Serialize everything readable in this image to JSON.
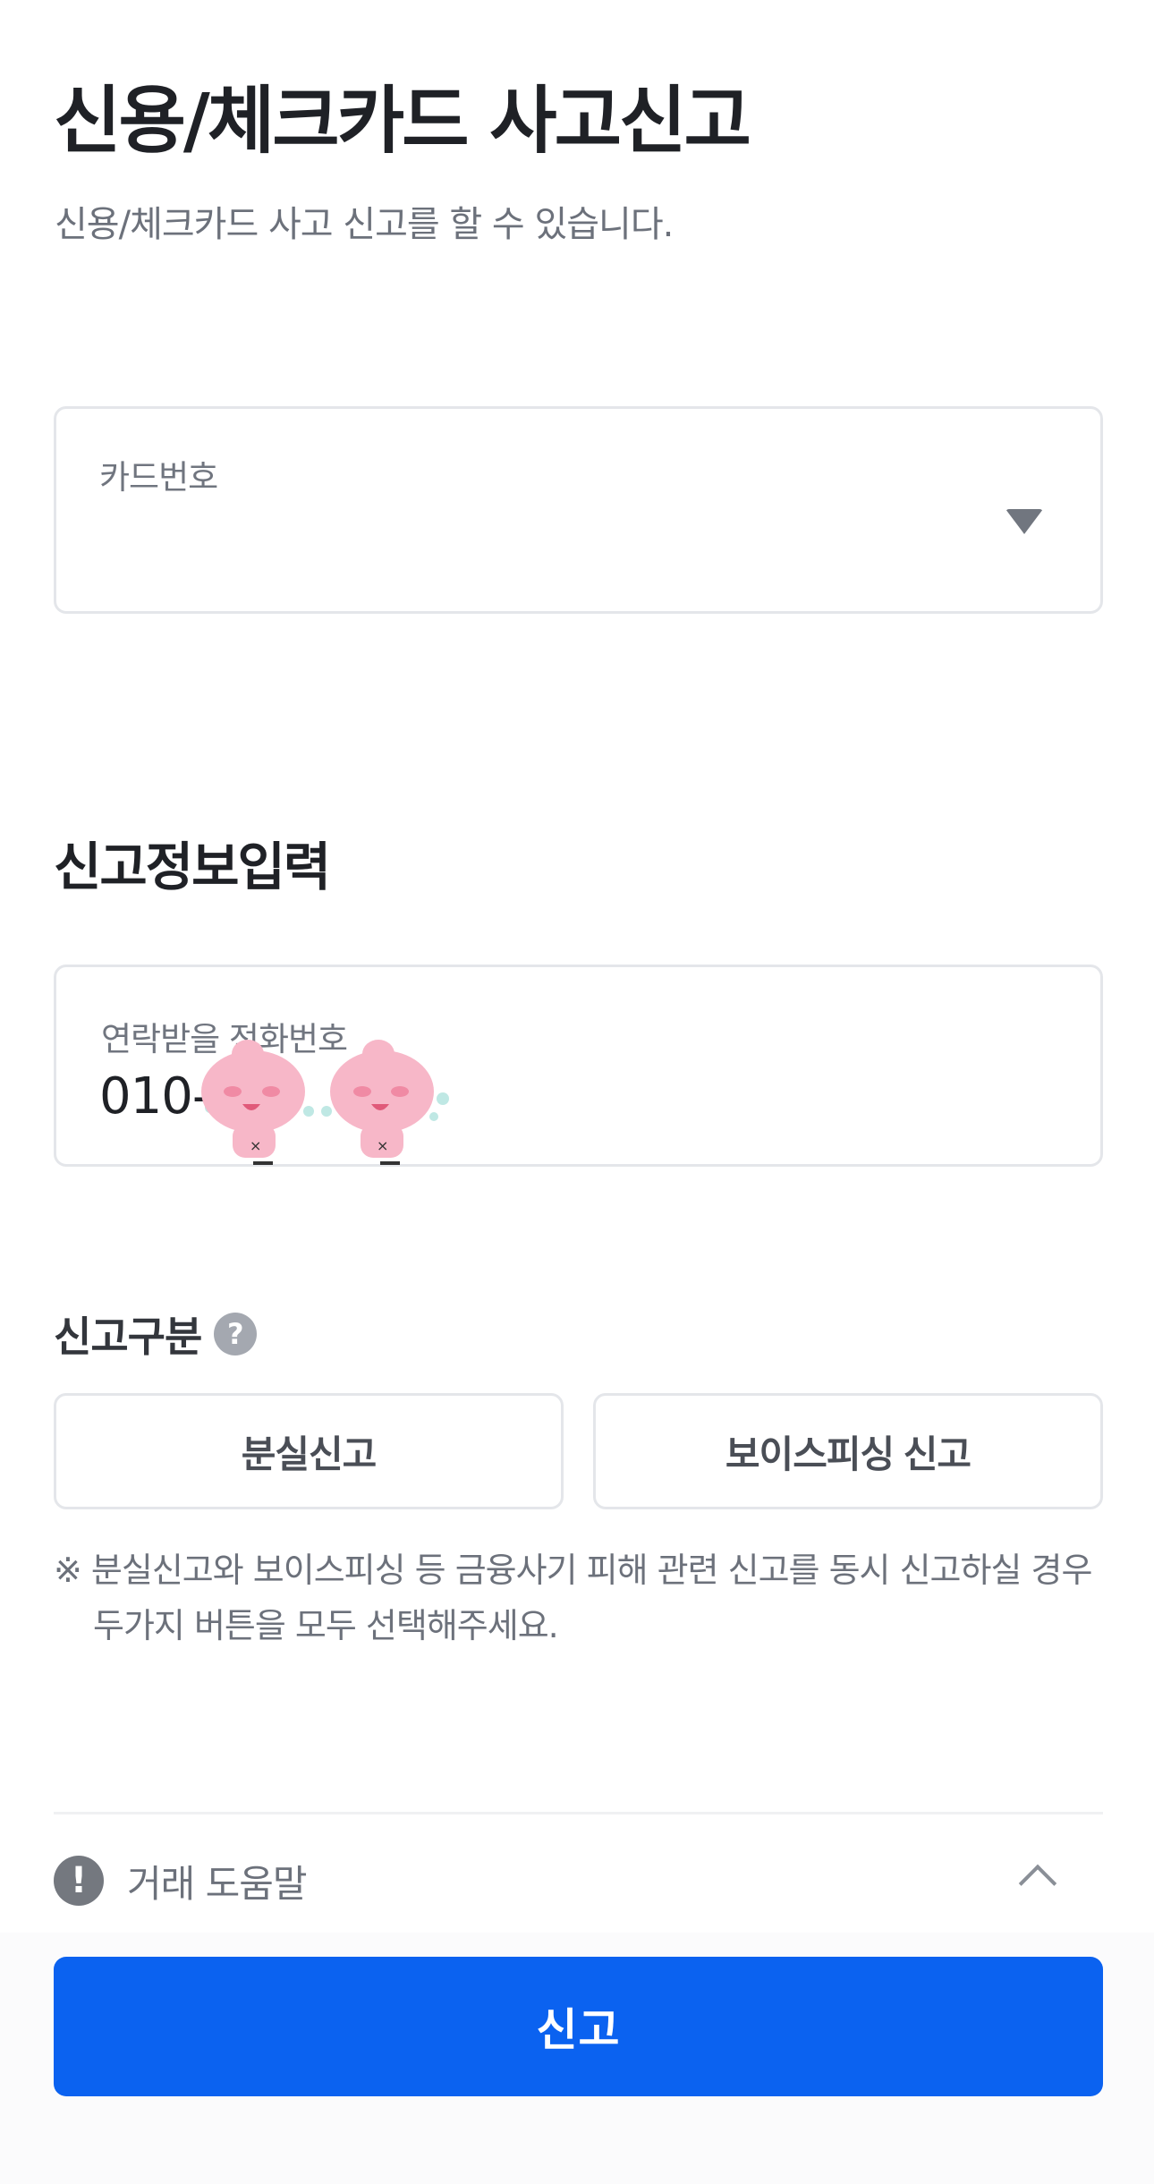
{
  "header": {
    "title": "신용/체크카드 사고신고",
    "subtitle": "신용/체크카드 사고 신고를 할 수 있습니다."
  },
  "card_select": {
    "label": "카드번호",
    "value": "",
    "icon": "caret-down-icon"
  },
  "report_info": {
    "section_title": "신고정보입력",
    "phone": {
      "label": "연락받을 전화번호",
      "value": "010-"
    }
  },
  "report_type": {
    "label": "신고구분",
    "help_icon": "question-icon",
    "help_symbol": "?",
    "options": [
      {
        "label": "분실신고"
      },
      {
        "label": "보이스피싱 신고"
      }
    ],
    "notice": "※ 분실신고와 보이스피싱 등 금융사기 피해 관련 신고를 동시 신고하실 경우 두가지 버튼을 모두 선택해주세요."
  },
  "help_section": {
    "icon": "exclamation-icon",
    "icon_symbol": "!",
    "label": "거래 도움말",
    "toggle_icon": "chevron-up-icon"
  },
  "submit": {
    "label": "신고"
  },
  "colors": {
    "primary": "#0b62f0",
    "text_dark": "#1f2126",
    "text_muted": "#6c717b",
    "border": "#e4e6ea",
    "sticker_pink": "#f7b7c8"
  }
}
